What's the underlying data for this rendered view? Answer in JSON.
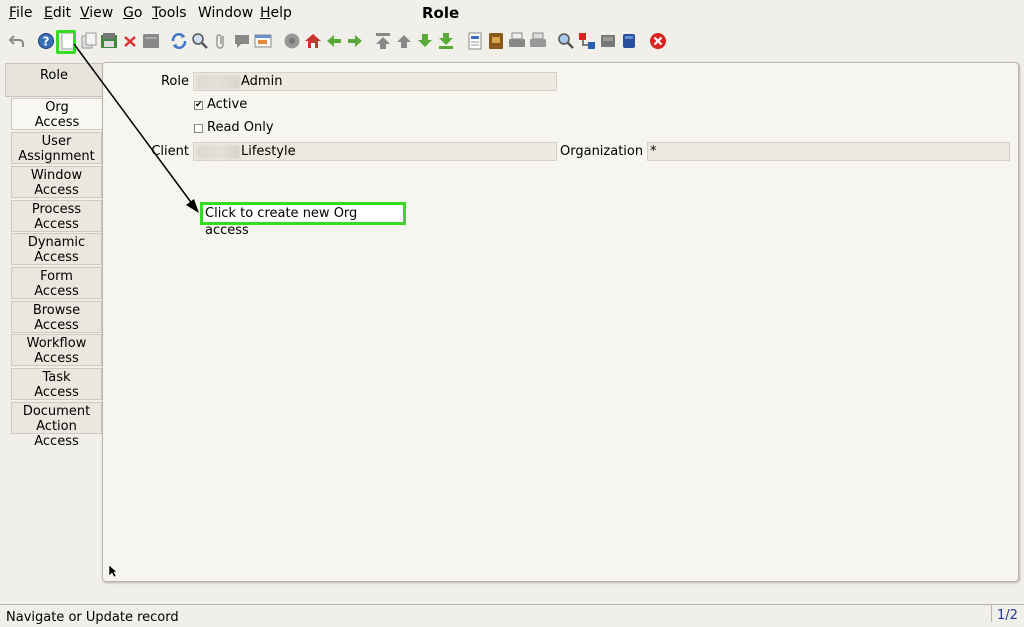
{
  "menu": {
    "file": "ile",
    "file_u": "F",
    "edit": "dit",
    "edit_u": "E",
    "view": "iew",
    "view_u": "V",
    "go": "o",
    "go_u": "G",
    "tools": "ools",
    "tools_u": "T",
    "window": "Window",
    "help": "elp",
    "help_u": "H"
  },
  "window_title": "Role",
  "toolbar_icons": [
    "undo-icon",
    "help-icon",
    "new-record-icon",
    "copy-record-icon",
    "save-icon",
    "delete-icon",
    "delete-selection-icon",
    "refresh-icon",
    "find-icon",
    "attachment-icon",
    "chat-icon",
    "history-icon",
    "menu-icon",
    "home-icon",
    "back-icon",
    "forward-icon",
    "first-record-icon",
    "previous-record-icon",
    "next-record-icon",
    "last-record-icon",
    "report-icon",
    "archive-icon",
    "print-icon",
    "print-preview-icon",
    "zoom-across-icon",
    "request-icon",
    "product-info-icon",
    "workflow-icon",
    "exit-icon"
  ],
  "tabs": {
    "role": "Role",
    "items": [
      {
        "l1": "Org",
        "l2": "Access"
      },
      {
        "l1": "User",
        "l2": "Assignment"
      },
      {
        "l1": "Window",
        "l2": "Access"
      },
      {
        "l1": "Process",
        "l2": "Access"
      },
      {
        "l1": "Dynamic",
        "l2": "Access"
      },
      {
        "l1": "Form",
        "l2": "Access"
      },
      {
        "l1": "Browse",
        "l2": "Access"
      },
      {
        "l1": "Workflow",
        "l2": "Access"
      },
      {
        "l1": "Task",
        "l2": "Access"
      },
      {
        "l1": "Document",
        "l2": "Action Access"
      }
    ]
  },
  "form": {
    "role_label": "Role",
    "role_value": "Admin",
    "active_label": "Active",
    "active_checked": true,
    "readonly_label": "Read Only",
    "readonly_checked": false,
    "client_label": "Client",
    "client_value": "Lifestyle",
    "org_label": "Organization",
    "org_value": "*"
  },
  "callout": "Click to create new Org access",
  "status": {
    "text": "Navigate or Update record",
    "page": "1/2"
  },
  "colors": {
    "highlight": "#33dd22",
    "background": "#f1efe9"
  }
}
